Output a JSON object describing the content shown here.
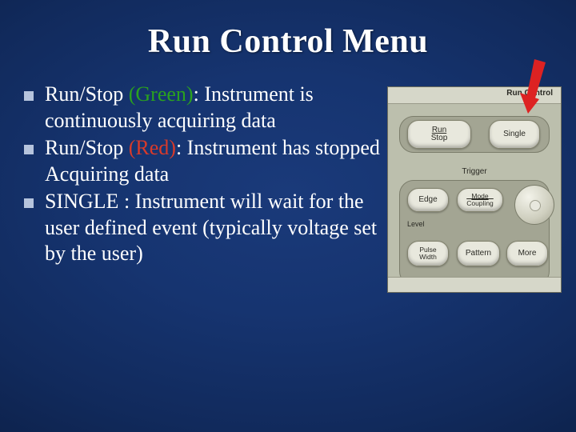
{
  "title": "Run Control Menu",
  "bullets": [
    {
      "prefix": "Run/Stop ",
      "colorWord": "(Green)",
      "colorClass": "green",
      "rest": ": Instrument is continuously acquiring data"
    },
    {
      "prefix": "Run/Stop ",
      "colorWord": "(Red)",
      "colorClass": "red",
      "rest": ": Instrument has stopped Acquiring data"
    },
    {
      "prefix": "SINGLE ",
      "colorWord": "",
      "colorClass": "",
      "rest": ": Instrument will wait for the user defined event (typically voltage set by the user)"
    }
  ],
  "panel": {
    "sectionLabel": "Run Control",
    "runStop": "Run\nStop",
    "single": "Single",
    "triggerLabel": "Trigger",
    "edge": "Edge",
    "modeCoupling": "Mode\nCoupling",
    "level": "Level",
    "pulseWidth": "Pulse\nWidth",
    "pattern": "Pattern",
    "more": "More"
  }
}
